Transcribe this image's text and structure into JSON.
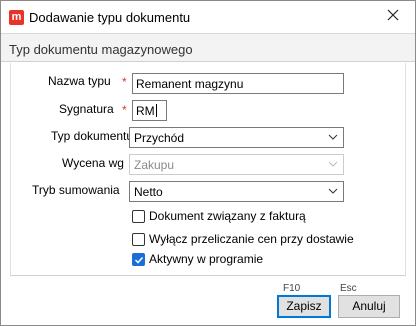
{
  "window": {
    "title": "Dodawanie typu dokumentu",
    "app_icon_letter": "m",
    "close_icon": "close-icon"
  },
  "header": {
    "text": "Typ dokumentu magazynowego"
  },
  "form": {
    "nazwa_typu": {
      "label": "Nazwa typu",
      "required_mark": "*",
      "value": "Remanent magzynu"
    },
    "sygnatura": {
      "label": "Sygnatura",
      "required_mark": "*",
      "value": "RM"
    },
    "typ_dokumentu": {
      "label": "Typ dokumentu",
      "value": "Przychód"
    },
    "wycena_wg": {
      "label": "Wycena wg",
      "value": "Zakupu"
    },
    "tryb_sumowania": {
      "label": "Tryb sumowania",
      "value": "Netto"
    }
  },
  "checkboxes": [
    {
      "label": "Dokument związany z fakturą",
      "checked": false
    },
    {
      "label": "Wyłącz przeliczanie cen przy dostawie",
      "checked": false
    },
    {
      "label": "Aktywny w programie",
      "checked": true
    }
  ],
  "footer": {
    "save_hint": "F10",
    "cancel_hint": "Esc",
    "save_label": "Zapisz",
    "cancel_label": "Anuluj"
  },
  "colors": {
    "app_icon": "#e8332a",
    "required": "#d33333",
    "checkbox_checked": "#1a6ed8",
    "default_button_border": "#0078d7"
  }
}
